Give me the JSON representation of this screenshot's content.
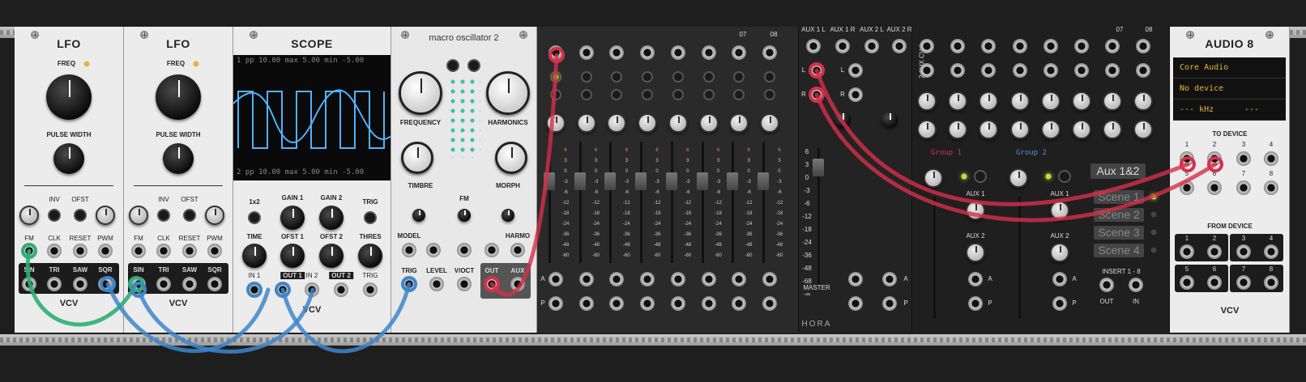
{
  "lfo1": {
    "title": "LFO",
    "freq": "FREQ",
    "pulse_width": "PULSE WIDTH",
    "inv": "INV",
    "ofst": "OFST",
    "fm": "FM",
    "clk": "CLK",
    "reset": "RESET",
    "pwm": "PWM",
    "sin": "SIN",
    "tri": "TRI",
    "saw": "SAW",
    "sqr": "SQR"
  },
  "lfo2": {
    "title": "LFO",
    "freq": "FREQ",
    "pulse_width": "PULSE WIDTH",
    "inv": "INV",
    "ofst": "OFST",
    "fm": "FM",
    "clk": "CLK",
    "reset": "RESET",
    "pwm": "PWM",
    "sin": "SIN",
    "tri": "TRI",
    "saw": "SAW",
    "sqr": "SQR"
  },
  "vcv_logo": "VCV",
  "scope": {
    "title": "SCOPE",
    "trace1": "1  pp  10.00 max  5.00 min -5.00",
    "trace2": "2  pp  10.00 max  5.00 min -5.00",
    "x1x2": "1x2",
    "gain1": "GAIN 1",
    "gain2": "GAIN 2",
    "trig": "TRIG",
    "time": "TIME",
    "ofst1": "OFST 1",
    "ofst2": "OFST 2",
    "thres": "THRES",
    "trig2": "TRIG",
    "in1": "IN 1",
    "out1": "OUT 1",
    "in2": "IN 2",
    "out2": "OUT 2"
  },
  "macro": {
    "title": "macro oscillator 2",
    "frequency": "FREQUENCY",
    "harmonics": "HARMONICS",
    "timbre": "TIMBRE",
    "fm": "FM",
    "morph": "MORPH",
    "model": "MODEL",
    "harmo": "HARMO",
    "trig": "TRIG",
    "level": "LEVEL",
    "voct": "V/OCT",
    "out": "OUT",
    "aux": "AUX"
  },
  "mixer": {
    "ch07": "07",
    "ch08": "08",
    "a": "A",
    "p": "P",
    "db_scale": [
      "6",
      "3",
      "0",
      "-3",
      "-6",
      "-12",
      "-18",
      "-24",
      "-36",
      "-48",
      "-60"
    ]
  },
  "master": {
    "aux1l": "AUX 1 L",
    "aux1r": "AUX 1 R",
    "aux2l": "AUX 2 L",
    "aux2r": "AUX 2 R",
    "l": "L",
    "r": "R",
    "master": "MASTER",
    "brand": "HORA",
    "scale": [
      "6",
      "3",
      "0",
      "-3",
      "-6",
      "-12",
      "-18",
      "-24",
      "-36",
      "-48",
      "-68",
      "-∞"
    ],
    "a": "A",
    "p": "P"
  },
  "groups": {
    "ch07": "07",
    "ch08": "08",
    "aux_cv": "2 AUX CV 1",
    "group1": "Group 1",
    "group2": "Group 2",
    "aux1": "AUX 1",
    "aux2": "AUX 2",
    "aux12": "Aux 1&2",
    "scenes": [
      "Scene 1",
      "Scene 2",
      "Scene 3",
      "Scene 4"
    ],
    "insert": "INSERT 1 - 8",
    "out": "OUT",
    "in": "IN",
    "a": "A",
    "p": "P"
  },
  "audio8": {
    "title": "AUDIO 8",
    "driver": "Core Audio",
    "device": "No device",
    "rate": "--- kHz",
    "block": "---",
    "to_device": "TO DEVICE",
    "from_device": "FROM DEVICE",
    "ch": [
      "1",
      "2",
      "3",
      "4",
      "5",
      "6",
      "7",
      "8"
    ]
  },
  "colors": {
    "cable_green": "#2fae74",
    "cable_blue": "#3f86c9",
    "cable_red": "#d6304a",
    "accent_orange": "#e8b53a"
  }
}
